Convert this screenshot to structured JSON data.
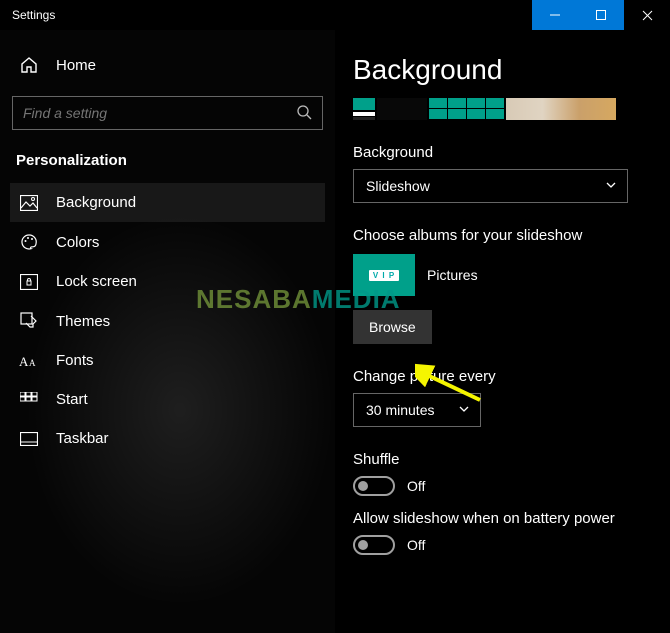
{
  "window": {
    "title": "Settings"
  },
  "sidebar": {
    "home": "Home",
    "search_placeholder": "Find a setting",
    "category": "Personalization",
    "items": [
      {
        "label": "Background"
      },
      {
        "label": "Colors"
      },
      {
        "label": "Lock screen"
      },
      {
        "label": "Themes"
      },
      {
        "label": "Fonts"
      },
      {
        "label": "Start"
      },
      {
        "label": "Taskbar"
      }
    ]
  },
  "main": {
    "page_title": "Background",
    "background_label": "Background",
    "background_value": "Slideshow",
    "albums_label": "Choose albums for your slideshow",
    "album_name": "Pictures",
    "browse": "Browse",
    "change_every_label": "Change picture every",
    "change_every_value": "30 minutes",
    "shuffle_label": "Shuffle",
    "shuffle_state": "Off",
    "battery_label": "Allow slideshow when on battery power",
    "battery_state": "Off"
  },
  "annotation": {
    "watermark": "NESABAMEDIA"
  }
}
